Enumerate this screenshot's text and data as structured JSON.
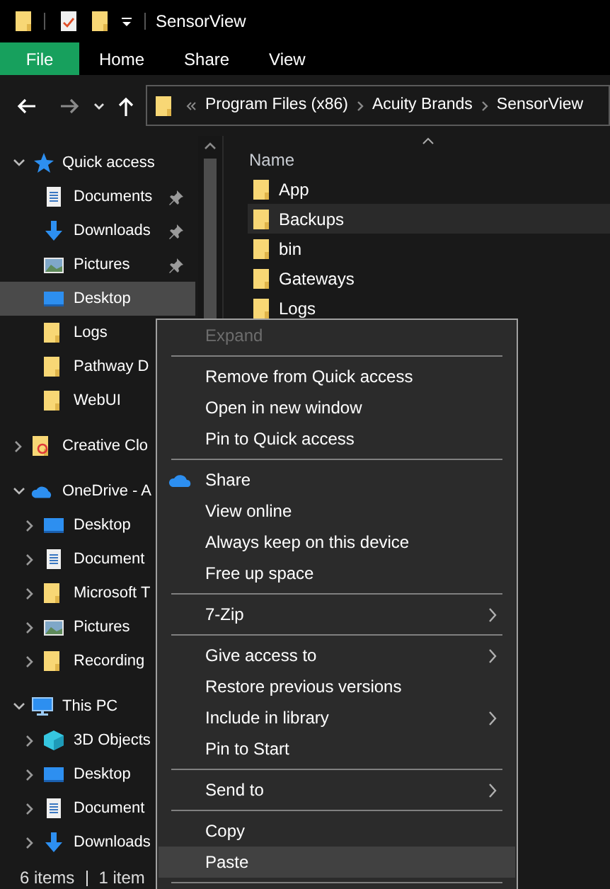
{
  "title_bar": {
    "title": "SensorView"
  },
  "ribbon_tabs": [
    {
      "label": "File",
      "kind": "file"
    },
    {
      "label": "Home",
      "kind": "tab"
    },
    {
      "label": "Share",
      "kind": "tab"
    },
    {
      "label": "View",
      "kind": "tab"
    }
  ],
  "address_bar": {
    "path": [
      "Program Files (x86)",
      "Acuity Brands",
      "SensorView"
    ]
  },
  "navigation_pane": {
    "items": [
      {
        "label": "Quick access",
        "kind": "quick_access",
        "expanded": true,
        "selected": false,
        "children": [
          {
            "label": "Documents",
            "kind": "documents",
            "pinned": true,
            "selected": false
          },
          {
            "label": "Downloads",
            "kind": "downloads",
            "pinned": true,
            "selected": false
          },
          {
            "label": "Pictures",
            "kind": "pictures",
            "pinned": true,
            "selected": false
          },
          {
            "label": "Desktop",
            "kind": "desktop",
            "pinned": false,
            "selected": true
          },
          {
            "label": "Logs",
            "kind": "folder",
            "pinned": false,
            "selected": false
          },
          {
            "label": "Pathway D",
            "kind": "folder",
            "pinned": false,
            "selected": false
          },
          {
            "label": "WebUI",
            "kind": "folder",
            "pinned": false,
            "selected": false
          }
        ]
      },
      {
        "label": "Creative Clo",
        "kind": "creative_cloud",
        "expanded": false,
        "selected": false
      },
      {
        "label": "OneDrive - A",
        "kind": "onedrive",
        "expanded": true,
        "selected": false,
        "children": [
          {
            "label": "Desktop",
            "kind": "desktop",
            "expanded": false,
            "selected": false
          },
          {
            "label": "Document",
            "kind": "documents",
            "expanded": false,
            "selected": false
          },
          {
            "label": "Microsoft T",
            "kind": "folder",
            "expanded": false,
            "selected": false
          },
          {
            "label": "Pictures",
            "kind": "pictures",
            "expanded": false,
            "selected": false
          },
          {
            "label": "Recording",
            "kind": "folder",
            "expanded": false,
            "selected": false
          }
        ]
      },
      {
        "label": "This PC",
        "kind": "this_pc",
        "expanded": true,
        "selected": false,
        "children": [
          {
            "label": "3D Objects",
            "kind": "objects_3d",
            "expanded": false,
            "selected": false
          },
          {
            "label": "Desktop",
            "kind": "desktop",
            "expanded": false,
            "selected": false
          },
          {
            "label": "Document",
            "kind": "documents",
            "expanded": false,
            "selected": false
          },
          {
            "label": "Downloads",
            "kind": "downloads",
            "expanded": false,
            "selected": false
          }
        ]
      }
    ]
  },
  "file_list": {
    "column": "Name",
    "items": [
      {
        "name": "App",
        "selected": false
      },
      {
        "name": "Backups",
        "selected": true
      },
      {
        "name": "bin",
        "selected": false
      },
      {
        "name": "Gateways",
        "selected": false
      },
      {
        "name": "Logs",
        "selected": false
      }
    ]
  },
  "context_menu": {
    "items": [
      {
        "kind": "item",
        "label": "Expand",
        "disabled": true,
        "submenu": false,
        "selected": false
      },
      {
        "kind": "separator"
      },
      {
        "kind": "item",
        "label": "Remove from Quick access",
        "disabled": false,
        "submenu": false,
        "selected": false
      },
      {
        "kind": "item",
        "label": "Open in new window",
        "disabled": false,
        "submenu": false,
        "selected": false
      },
      {
        "kind": "item",
        "label": "Pin to Quick access",
        "disabled": false,
        "submenu": false,
        "selected": false
      },
      {
        "kind": "separator"
      },
      {
        "kind": "cloud_item",
        "label": "Share",
        "disabled": false,
        "submenu": false,
        "selected": false
      },
      {
        "kind": "item",
        "label": "View online",
        "disabled": false,
        "submenu": false,
        "selected": false
      },
      {
        "kind": "item",
        "label": "Always keep on this device",
        "disabled": false,
        "submenu": false,
        "selected": false
      },
      {
        "kind": "item",
        "label": "Free up space",
        "disabled": false,
        "submenu": false,
        "selected": false
      },
      {
        "kind": "separator"
      },
      {
        "kind": "item",
        "label": "7-Zip",
        "disabled": false,
        "submenu": true,
        "selected": false
      },
      {
        "kind": "separator"
      },
      {
        "kind": "item",
        "label": "Give access to",
        "disabled": false,
        "submenu": true,
        "selected": false
      },
      {
        "kind": "item",
        "label": "Restore previous versions",
        "disabled": false,
        "submenu": false,
        "selected": false
      },
      {
        "kind": "item",
        "label": "Include in library",
        "disabled": false,
        "submenu": true,
        "selected": false
      },
      {
        "kind": "item",
        "label": "Pin to Start",
        "disabled": false,
        "submenu": false,
        "selected": false
      },
      {
        "kind": "separator"
      },
      {
        "kind": "item",
        "label": "Send to",
        "disabled": false,
        "submenu": true,
        "selected": false
      },
      {
        "kind": "separator"
      },
      {
        "kind": "item",
        "label": "Copy",
        "disabled": false,
        "submenu": false,
        "selected": false
      },
      {
        "kind": "item",
        "label": "Paste",
        "disabled": false,
        "submenu": false,
        "selected": true
      },
      {
        "kind": "separator"
      }
    ]
  },
  "status_bar": {
    "item_count": "6 items",
    "selection": "1 item"
  }
}
